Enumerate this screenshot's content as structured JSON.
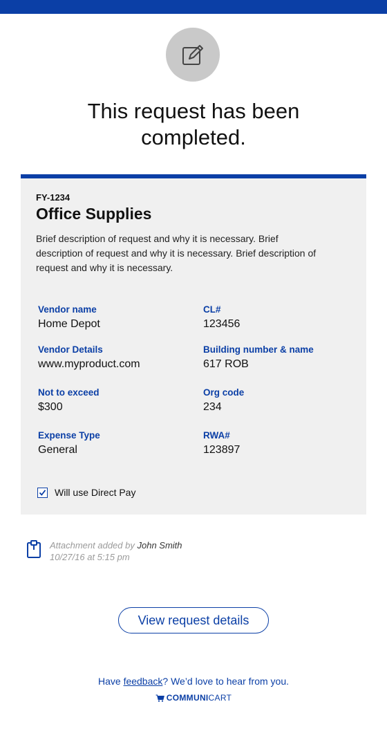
{
  "header": {
    "status_message": "This request has been completed."
  },
  "request": {
    "id": "FY-1234",
    "title": "Office Supplies",
    "description": "Brief description of request and why it is necessary. Brief description of request and why it is necessary. Brief description of request and why it is necessary.",
    "fields": [
      {
        "label": "Vendor name",
        "value": "Home Depot"
      },
      {
        "label": "CL#",
        "value": "123456"
      },
      {
        "label": "Vendor Details",
        "value": "www.myproduct.com"
      },
      {
        "label": "Building number & name",
        "value": "617 ROB"
      },
      {
        "label": "Not to exceed",
        "value": "$300"
      },
      {
        "label": "Org code",
        "value": "234"
      },
      {
        "label": "Expense Type",
        "value": "General"
      },
      {
        "label": "RWA#",
        "value": "123897"
      }
    ],
    "direct_pay": {
      "label": "Will use Direct Pay",
      "checked": true
    }
  },
  "attachment": {
    "prefix": "Attachment added by",
    "author": "John Smith",
    "timestamp": "10/27/16 at 5:15 pm"
  },
  "actions": {
    "view_details_label": "View request details"
  },
  "footer": {
    "feedback_prefix": "Have",
    "feedback_link": "feedback",
    "feedback_suffix": "? We’d love to hear from you.",
    "brand_part1": "COMMUNI",
    "brand_part2": "CART"
  },
  "colors": {
    "brand_blue": "#0b3fa6",
    "card_bg": "#f0f0f0",
    "icon_circle": "#c9c9c9"
  },
  "icons": {
    "status": "edit-icon",
    "attachment": "clipboard-icon",
    "brand": "cart-icon",
    "checkbox": "check-icon"
  }
}
